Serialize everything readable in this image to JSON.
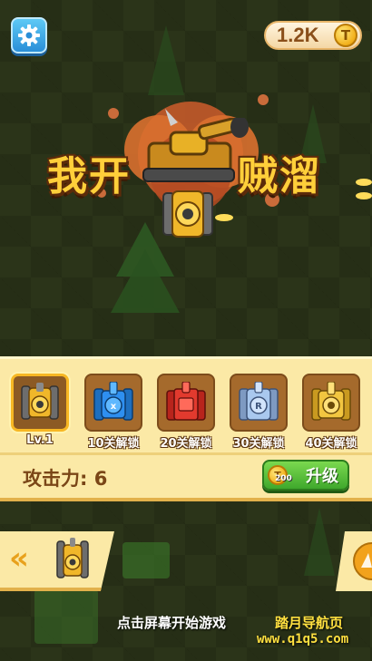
{
  "hud": {
    "settings_icon": "gear-icon",
    "coins": "1.2K",
    "coin_icon": "coin-icon",
    "coin_symbol": "T"
  },
  "title": {
    "left": "我开",
    "right": "贼溜"
  },
  "upgrade_panel": {
    "tanks": [
      {
        "label": "Lv.1",
        "color": "#f0b72a",
        "selected": true
      },
      {
        "label": "10关解锁",
        "color": "#2e8ff0",
        "selected": false
      },
      {
        "label": "20关解锁",
        "color": "#e23a2e",
        "selected": false
      },
      {
        "label": "30关解锁",
        "color": "#a9c8ee",
        "selected": false
      },
      {
        "label": "40关解锁",
        "color": "#f2c640",
        "selected": false
      }
    ],
    "attack": "攻击力: 6",
    "upgrade_cost": "200",
    "upgrade_label": "升级"
  },
  "bottom": {
    "prev_icon": "double-chevron-left-icon",
    "start_hint": "点击屏幕开始游戏",
    "watermark_name": "踏月导航页",
    "watermark_url": "www.q1q5.com"
  },
  "colors": {
    "panel_bg": "#fbe9a6",
    "accent_gold": "#ffcf3a",
    "upgrade_green": "#4fbf34"
  }
}
